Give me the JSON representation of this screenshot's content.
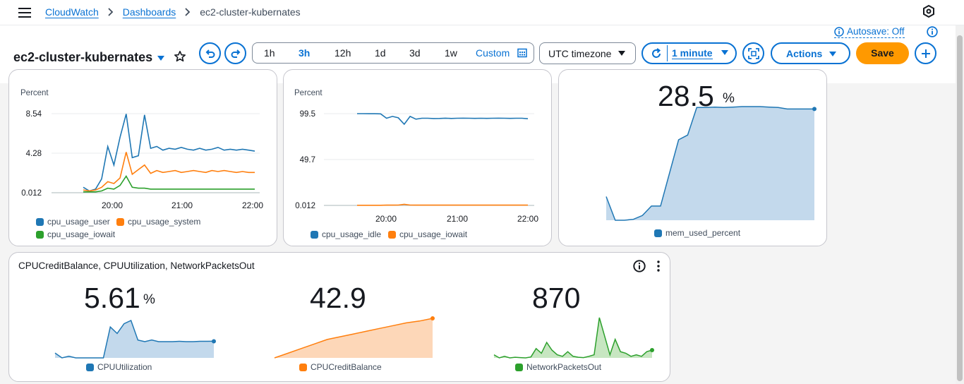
{
  "breadcrumb": {
    "items": [
      "CloudWatch",
      "Dashboards"
    ],
    "current": "ec2-cluster-kubernates"
  },
  "header": {
    "title": "ec2-cluster-kubernates",
    "autosave": "Autosave: Off",
    "time_ranges": [
      "1h",
      "3h",
      "12h",
      "1d",
      "3d",
      "1w"
    ],
    "active_range": "3h",
    "custom_label": "Custom",
    "timezone": "UTC timezone",
    "refresh_interval": "1 minute",
    "actions_label": "Actions",
    "save_label": "Save"
  },
  "colors": {
    "accent": "#0972d3",
    "save": "#ff9900",
    "blue_series": "#1f77b4",
    "orange_series": "#ff7f0e",
    "green_series": "#2ca02c"
  },
  "widgets": {
    "cpu": {
      "ylabel": "Percent",
      "yticks": [
        "8.54",
        "4.28",
        "0.012"
      ],
      "xticks": [
        "20:00",
        "21:00",
        "22:00"
      ],
      "legend": [
        "cpu_usage_user",
        "cpu_usage_system",
        "cpu_usage_iowait"
      ]
    },
    "idle": {
      "ylabel": "Percent",
      "yticks": [
        "99.5",
        "49.7",
        "0.012"
      ],
      "xticks": [
        "20:00",
        "21:00",
        "22:00"
      ],
      "legend": [
        "cpu_usage_idle",
        "cpu_usage_iowait"
      ]
    },
    "mem": {
      "value": "28.5",
      "unit": "%",
      "legend": "mem_used_percent"
    },
    "credit": {
      "title": "CPUCreditBalance, CPUUtilization, NetworkPacketsOut",
      "cpu_value": "5.61",
      "cpu_unit": "%",
      "cpu_legend": "CPUUtilization",
      "credit_value": "42.9",
      "credit_legend": "CPUCreditBalance",
      "net_value": "870",
      "net_legend": "NetworkPacketsOut"
    }
  },
  "chart_data": [
    {
      "type": "line",
      "ylabel": "Percent",
      "x": [
        "19:40",
        "19:45",
        "19:50",
        "19:55",
        "20:00",
        "20:05",
        "20:10",
        "20:15",
        "20:20",
        "20:25",
        "20:30",
        "20:35",
        "20:40",
        "20:45",
        "20:50",
        "20:55",
        "21:00",
        "21:05",
        "21:10",
        "21:15",
        "21:20",
        "21:25",
        "21:30",
        "21:35",
        "21:40",
        "21:45",
        "21:50",
        "21:55",
        "22:00"
      ],
      "series": [
        {
          "name": "cpu_usage_user",
          "values": [
            0.6,
            0.2,
            0.4,
            1.5,
            5.0,
            3.0,
            6.0,
            8.5,
            3.8,
            4.0,
            8.4,
            4.8,
            5.0,
            4.6,
            4.8,
            4.7,
            4.9,
            4.7,
            4.6,
            4.8,
            4.6,
            4.7,
            4.9,
            4.6,
            4.7,
            4.6,
            4.7,
            4.6,
            4.5
          ]
        },
        {
          "name": "cpu_usage_system",
          "values": [
            0.3,
            0.2,
            0.3,
            0.6,
            1.2,
            1.0,
            1.6,
            4.4,
            2.0,
            2.5,
            3.0,
            2.1,
            2.4,
            2.2,
            2.3,
            2.4,
            2.2,
            2.3,
            2.4,
            2.3,
            2.2,
            2.4,
            2.3,
            2.4,
            2.3,
            2.2,
            2.3,
            2.2,
            2.2
          ]
        },
        {
          "name": "cpu_usage_iowait",
          "values": [
            0.1,
            0.1,
            0.1,
            0.2,
            0.5,
            0.4,
            0.8,
            1.8,
            0.6,
            0.5,
            0.5,
            0.4,
            0.4,
            0.4,
            0.4,
            0.4,
            0.4,
            0.4,
            0.4,
            0.4,
            0.4,
            0.4,
            0.4,
            0.4,
            0.4,
            0.4,
            0.4,
            0.4,
            0.4
          ]
        }
      ],
      "xticks": [
        "20:00",
        "21:00",
        "22:00"
      ],
      "yticks": [
        0.012,
        4.28,
        8.54
      ],
      "ylim": [
        0.012,
        8.54
      ]
    },
    {
      "type": "line",
      "ylabel": "Percent",
      "x": [
        "19:35",
        "19:40",
        "19:45",
        "19:50",
        "19:55",
        "20:00",
        "20:05",
        "20:10",
        "20:15",
        "20:20",
        "20:25",
        "20:30",
        "20:35",
        "20:40",
        "20:45",
        "20:50",
        "20:55",
        "21:00",
        "21:05",
        "21:10",
        "21:15",
        "21:20",
        "21:25",
        "21:30",
        "21:35",
        "21:40",
        "21:45",
        "21:50",
        "21:55",
        "22:00"
      ],
      "series": [
        {
          "name": "cpu_usage_idle",
          "values": [
            99.5,
            99.5,
            99.4,
            99.4,
            99.3,
            94.5,
            96.5,
            95.0,
            88.0,
            96.5,
            93.5,
            94.5,
            94.5,
            94.2,
            94.3,
            94.6,
            94.3,
            94.5,
            94.6,
            94.5,
            94.4,
            94.5,
            94.4,
            94.5,
            94.6,
            94.5,
            94.4,
            94.5,
            94.5,
            94.0
          ]
        },
        {
          "name": "cpu_usage_iowait",
          "values": [
            0.2,
            0.2,
            0.2,
            0.2,
            0.2,
            0.3,
            0.3,
            0.4,
            1.2,
            0.4,
            0.3,
            0.3,
            0.3,
            0.3,
            0.3,
            0.3,
            0.3,
            0.3,
            0.3,
            0.3,
            0.3,
            0.3,
            0.3,
            0.3,
            0.3,
            0.3,
            0.3,
            0.3,
            0.3,
            0.3
          ]
        }
      ],
      "xticks": [
        "20:00",
        "21:00",
        "22:00"
      ],
      "yticks": [
        0.012,
        49.7,
        99.5
      ],
      "ylim": [
        0.012,
        99.5
      ]
    },
    {
      "type": "area",
      "series": [
        {
          "name": "mem_used_percent",
          "values": [
            10.0,
            5.0,
            5.0,
            5.2,
            6.0,
            8.0,
            8.0,
            15.0,
            22.0,
            23.0,
            28.8,
            28.8,
            28.9,
            28.8,
            28.9,
            29.0,
            29.0,
            29.0,
            28.9,
            28.8,
            28.5,
            28.5,
            28.5,
            28.5
          ]
        }
      ],
      "last_value": 28.5
    },
    {
      "type": "area",
      "series": [
        {
          "name": "CPUUtilization",
          "values": [
            2.0,
            0.5,
            1.0,
            0.5,
            0.5,
            0.5,
            0.5,
            0.5,
            10.0,
            8.0,
            11.0,
            12.0,
            6.0,
            5.5,
            6.0,
            5.5,
            5.5,
            5.5,
            5.6,
            5.5,
            5.5,
            5.6,
            5.6,
            5.61
          ]
        }
      ],
      "last_value": 5.61
    },
    {
      "type": "area",
      "series": [
        {
          "name": "CPUCreditBalance",
          "values": [
            0,
            5,
            10,
            15,
            20,
            23,
            26,
            29,
            32,
            35,
            38,
            40,
            42.9
          ]
        }
      ],
      "last_value": 42.9
    },
    {
      "type": "area",
      "series": [
        {
          "name": "NetworkPacketsOut",
          "values": [
            200,
            100,
            150,
            100,
            120,
            110,
            100,
            130,
            400,
            250,
            600,
            350,
            200,
            150,
            300,
            150,
            120,
            110,
            150,
            200,
            1400,
            800,
            200,
            700,
            300,
            250,
            150,
            200,
            150,
            300,
            350
          ]
        }
      ],
      "last_value": 870
    }
  ]
}
